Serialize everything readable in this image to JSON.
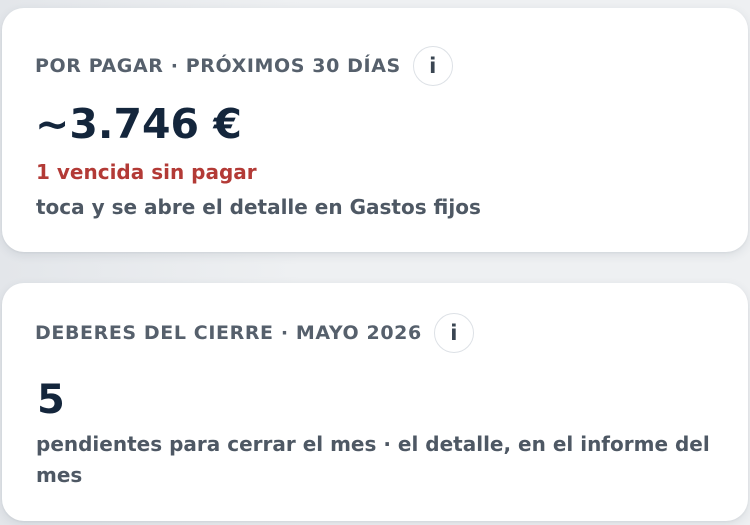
{
  "cards": {
    "payable": {
      "title": "POR PAGAR · PRÓXIMOS 30 DÍAS",
      "info_icon": "i",
      "amount": "~3.746 €",
      "overdue": "1 vencida sin pagar",
      "hint": "toca y se abre el detalle en Gastos fijos"
    },
    "closing": {
      "title": "DEBERES DEL CIERRE · MAYO 2026",
      "info_icon": "i",
      "count": "5",
      "hint": "pendientes para cerrar el mes · el detalle, en el informe del mes"
    }
  },
  "colors": {
    "title": "#56606c",
    "value": "#14263c",
    "overdue": "#b33a36",
    "hint": "#4e5864",
    "card_bg": "#ffffff",
    "page_bg": "#e6e9ed"
  }
}
